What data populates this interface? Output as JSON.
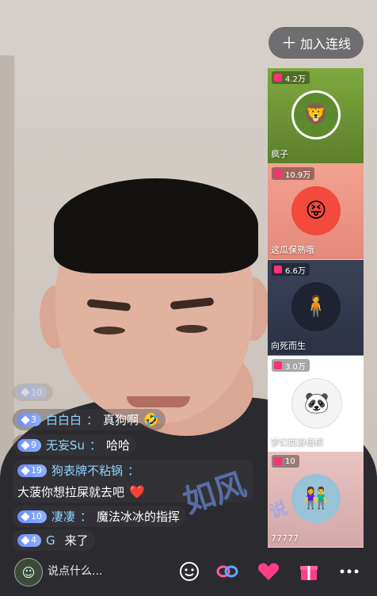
{
  "header": {
    "add_link_label": "加入连线"
  },
  "guests": [
    {
      "count": "4.2万",
      "name": "疯子",
      "avatar_icon": "lion-icon"
    },
    {
      "count": "10.9万",
      "name": "这瓜保熟哦",
      "avatar_icon": "cartoon-icon"
    },
    {
      "count": "6.6万",
      "name": "向死而生",
      "avatar_icon": "person-icon"
    },
    {
      "count": "3.0万",
      "name": "梦幻西游梧桐",
      "avatar_icon": "sketch-icon"
    },
    {
      "count": "10",
      "name": "77777",
      "avatar_icon": "couple-icon"
    }
  ],
  "chat": [
    {
      "level": "10",
      "user": "",
      "sep": "",
      "text": "",
      "emoji": ""
    },
    {
      "level": "3",
      "user": "白白白",
      "sep": "：",
      "text": "真狗啊",
      "emoji": "🤣"
    },
    {
      "level": "9",
      "user": "无妄Su",
      "sep": "：",
      "text": "哈哈",
      "emoji": ""
    },
    {
      "level": "19",
      "user": "狗表牌不粘锅",
      "sep": "：",
      "text": "大菠你想拉屎就去吧",
      "emoji": "❤️"
    },
    {
      "level": "10",
      "user": "凄凄",
      "sep": "：",
      "text": "魔法冰冰的指挥",
      "emoji": ""
    },
    {
      "level": "4",
      "user": "G",
      "sep": " ",
      "text": "来了",
      "emoji": ""
    }
  ],
  "watermark": {
    "main": "如风",
    "tail": "说"
  },
  "bottom": {
    "comment_placeholder": "说点什么..."
  },
  "colors": {
    "accent_pink": "#ff2f7a",
    "level_badge": "#7a99ff"
  }
}
